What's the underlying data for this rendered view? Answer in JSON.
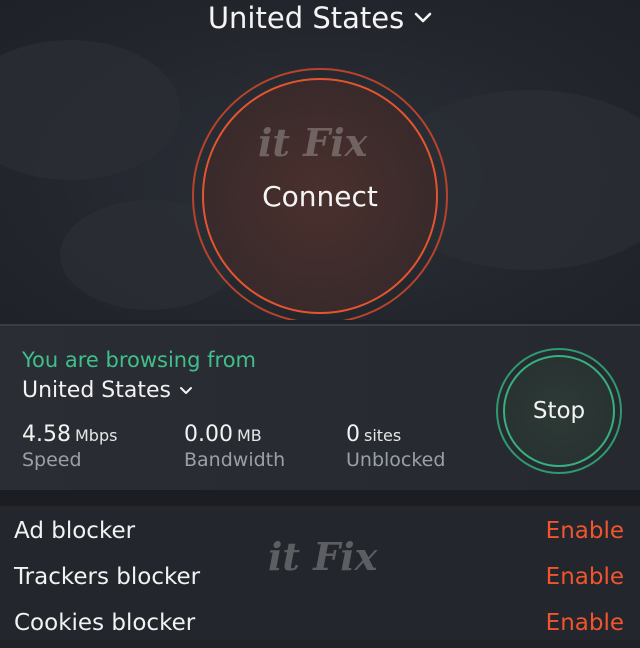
{
  "header": {
    "location": "United States"
  },
  "connect": {
    "label": "Connect"
  },
  "watermark": {
    "text": "it Fix"
  },
  "status": {
    "browsing_label": "You are browsing from",
    "browsing_country": "United States",
    "stats": [
      {
        "value": "4.58",
        "unit": "Mbps",
        "label": "Speed"
      },
      {
        "value": "0.00",
        "unit": "MB",
        "label": "Bandwidth"
      },
      {
        "value": "0",
        "unit": "sites",
        "label": "Unblocked"
      }
    ],
    "stop_label": "Stop"
  },
  "features": [
    {
      "name": "Ad blocker",
      "action": "Enable"
    },
    {
      "name": "Trackers blocker",
      "action": "Enable"
    },
    {
      "name": "Cookies blocker",
      "action": "Enable"
    }
  ],
  "colors": {
    "accent_orange": "#f0552e",
    "accent_green": "#3fc08a",
    "background": "#1f2229"
  }
}
